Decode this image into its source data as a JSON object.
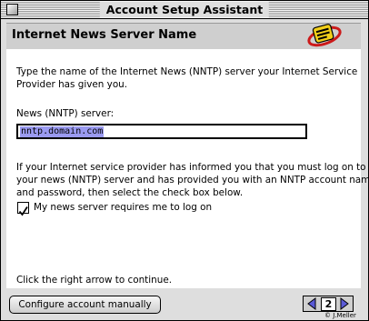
{
  "window": {
    "title": "Account Setup Assistant"
  },
  "header": {
    "title": "Internet News Server Name",
    "icon": "assistant-icon"
  },
  "intro": {
    "line1": "Type the name of the Internet News (NNTP) server your Internet Service",
    "line2": "Provider has given you."
  },
  "server_field": {
    "label": "News (NNTP) server:",
    "value": "nntp.domain.com"
  },
  "info": {
    "line1": "If your Internet service provider has informed you that you must log on to",
    "line2": "your news (NNTP) server and has provided you with an NNTP account name",
    "line3": "and password, then select the check box below."
  },
  "login_checkbox": {
    "label": "My news server requires me to log on",
    "checked": true
  },
  "footer_hint": "Click the right arrow to continue.",
  "buttons": {
    "configure_manually": "Configure account manually"
  },
  "navigation": {
    "page": "2"
  },
  "credit": "© J.Meller"
}
